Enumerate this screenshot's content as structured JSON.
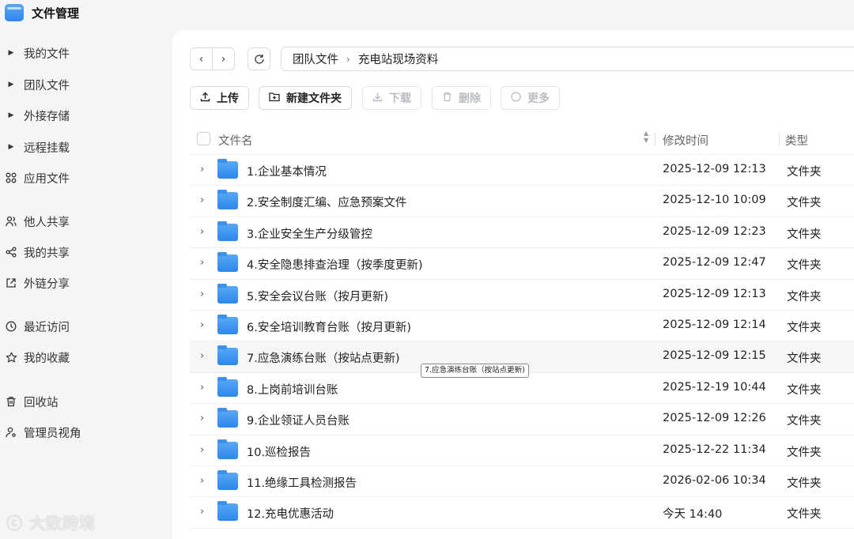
{
  "app": {
    "title": "文件管理"
  },
  "sidebar": {
    "items": [
      {
        "label": "我的文件"
      },
      {
        "label": "团队文件"
      },
      {
        "label": "外接存储"
      },
      {
        "label": "远程挂载"
      },
      {
        "label": "应用文件"
      },
      {
        "label": "他人共享"
      },
      {
        "label": "我的共享"
      },
      {
        "label": "外链分享"
      },
      {
        "label": "最近访问"
      },
      {
        "label": "我的收藏"
      },
      {
        "label": "回收站"
      },
      {
        "label": "管理员视角"
      }
    ]
  },
  "watermark": "大数跨境",
  "breadcrumb": {
    "parent": "团队文件",
    "current": "充电站现场资料"
  },
  "toolbar": {
    "upload_label": "上传",
    "new_folder_label": "新建文件夹",
    "download_label": "下载",
    "delete_label": "删除",
    "more_label": "更多"
  },
  "table": {
    "headers": {
      "name": "文件名",
      "mtime": "修改时间",
      "type": "类型"
    },
    "rows": [
      {
        "name": "1.企业基本情况",
        "mtime": "2025-12-09 12:13",
        "type": "文件夹"
      },
      {
        "name": "2.安全制度汇编、应急预案文件",
        "mtime": "2025-12-10 10:09",
        "type": "文件夹"
      },
      {
        "name": "3.企业安全生产分级管控",
        "mtime": "2025-12-09 12:23",
        "type": "文件夹"
      },
      {
        "name": "4.安全隐患排查治理（按季度更新)",
        "mtime": "2025-12-09 12:47",
        "type": "文件夹"
      },
      {
        "name": "5.安全会议台账（按月更新)",
        "mtime": "2025-12-09 12:13",
        "type": "文件夹"
      },
      {
        "name": "6.安全培训教育台账（按月更新)",
        "mtime": "2025-12-09 12:14",
        "type": "文件夹"
      },
      {
        "name": "7.应急演练台账（按站点更新)",
        "mtime": "2025-12-09 12:15",
        "type": "文件夹"
      },
      {
        "name": "8.上岗前培训台账",
        "mtime": "2025-12-19 10:44",
        "type": "文件夹"
      },
      {
        "name": "9.企业领证人员台账",
        "mtime": "2025-12-09 12:26",
        "type": "文件夹"
      },
      {
        "name": "10.巡检报告",
        "mtime": "2025-12-22 11:34",
        "type": "文件夹"
      },
      {
        "name": "11.绝缘工具检测报告",
        "mtime": "2026-02-06 10:34",
        "type": "文件夹"
      },
      {
        "name": "12.充电优惠活动",
        "mtime": "今天 14:40",
        "type": "文件夹"
      }
    ]
  },
  "tooltip": "7.应急演练台账（按站点更新)",
  "colors": {
    "accent": "#2f86ea",
    "folder": "#3b91ee",
    "hover_row": "#f5f6f8"
  }
}
